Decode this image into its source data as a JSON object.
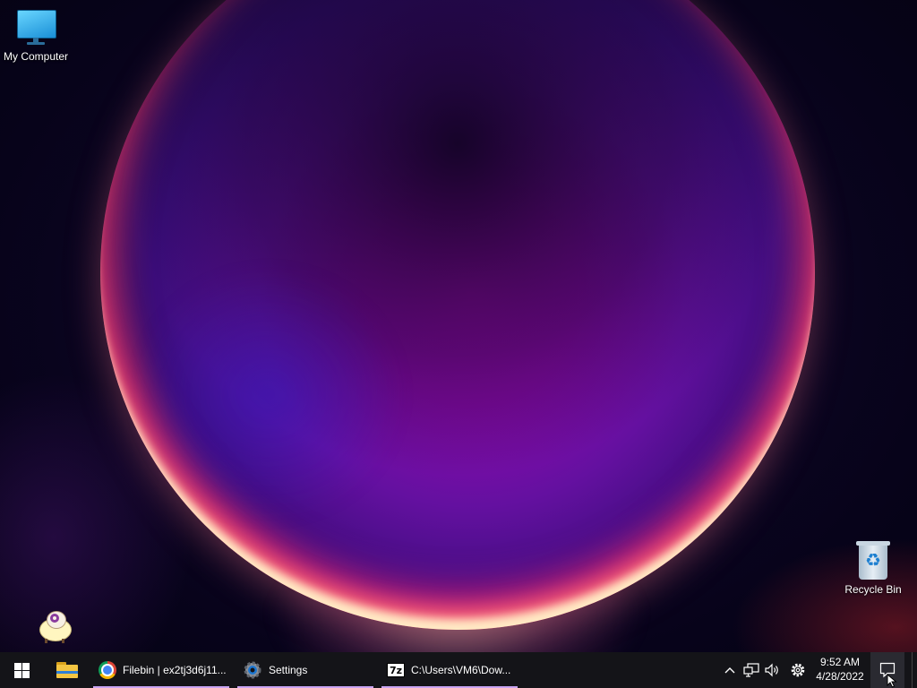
{
  "desktop": {
    "icons": {
      "my_computer": "My Computer",
      "recycle_bin": "Recycle Bin"
    }
  },
  "taskbar": {
    "tasks": [
      {
        "label": "Filebin | ex2tj3d6j11...",
        "icon": "chrome-icon"
      },
      {
        "label": "Settings",
        "icon": "gear-icon"
      },
      {
        "label": "C:\\Users\\VM6\\Dow...",
        "icon": "7zip-icon"
      }
    ],
    "sevenz_glyph": "7z",
    "clock": {
      "time": "9:52 AM",
      "date": "4/28/2022"
    }
  },
  "colors": {
    "taskbar_bg": "#141418",
    "task_underline": "#c9a4f2",
    "orb_core": "#a00ab8"
  }
}
